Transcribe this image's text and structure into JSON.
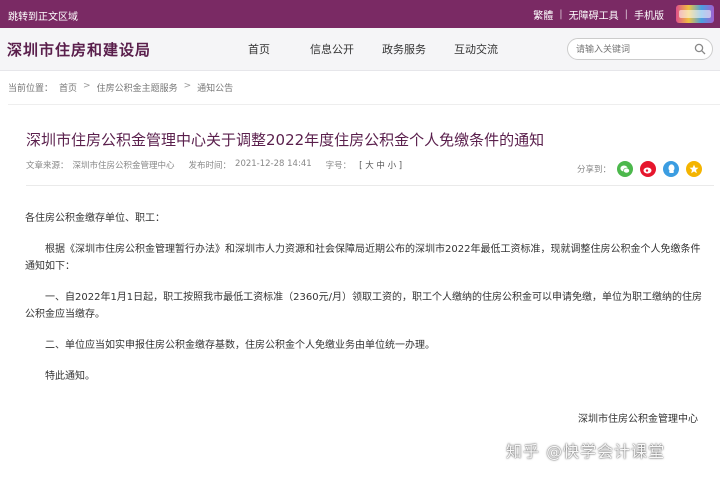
{
  "topbar": {
    "skip_link": "跳转到正文区域",
    "traditional": "繁體",
    "accessibility": "无障碍工具",
    "mobile": "手机版"
  },
  "header": {
    "site_title": "深圳市住房和建设局",
    "nav": [
      "首页",
      "信息公开",
      "政务服务",
      "互动交流"
    ],
    "search_placeholder": "请输入关键词"
  },
  "breadcrumb": {
    "label": "当前位置：",
    "items": [
      "首页",
      "住房公积金主题服务",
      "通知公告"
    ]
  },
  "article": {
    "title": "深圳市住房公积金管理中心关于调整2022年度住房公积金个人免缴条件的通知",
    "source_label": "文章来源：",
    "source": "深圳市住房公积金管理中心",
    "time_label": "发布时间：",
    "time": "2021-12-28 14:41",
    "font_label": "字号：",
    "font_sizes": "[ 大  中  小 ]",
    "share_label": "分享到：",
    "salutation": "各住房公积金缴存单位、职工：",
    "paragraphs": [
      "根据《深圳市住房公积金管理暂行办法》和深圳市人力资源和社会保障局近期公布的深圳市2022年最低工资标准，现就调整住房公积金个人免缴条件通知如下：",
      "一、自2022年1月1日起，职工按照我市最低工资标准（2360元/月）领取工资的，职工个人缴纳的住房公积金可以申请免缴，单位为职工缴纳的住房公积金应当缴存。",
      "二、单位应当如实申报住房公积金缴存基数，住房公积金个人免缴业务由单位统一办理。",
      "特此通知。"
    ],
    "signature": "深圳市住房公积金管理中心"
  },
  "watermark": "知乎 @快学会计课堂",
  "colors": {
    "brand": "#7a2a64",
    "title": "#5a1f4c",
    "wechat": "#4cb84c",
    "weibo": "#e6162d",
    "qzone": "#3b9de1",
    "favorite": "#f4b400"
  }
}
